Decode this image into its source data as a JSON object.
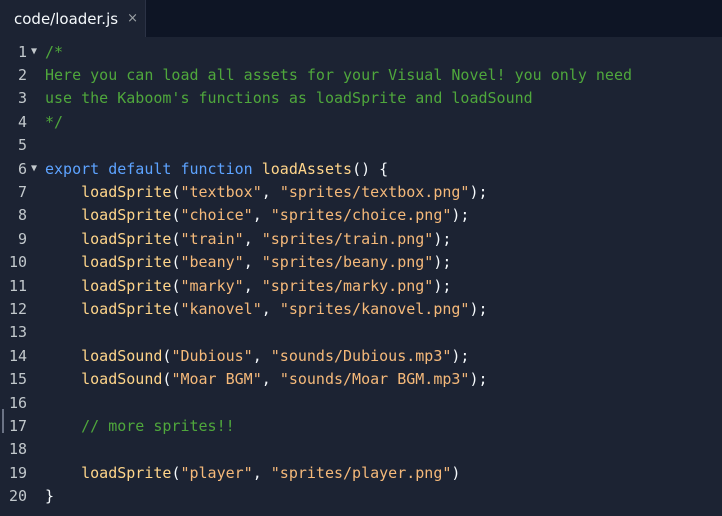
{
  "tab": {
    "title": "code/loader.js",
    "close": "×"
  },
  "fold_marker": "▼",
  "lines": [
    {
      "n": "1",
      "fold": true,
      "tokens": [
        {
          "t": "/*",
          "c": "comment"
        }
      ]
    },
    {
      "n": "2",
      "tokens": [
        {
          "t": "Here you can load all assets for your Visual Novel! you only need",
          "c": "comment"
        }
      ]
    },
    {
      "n": "3",
      "tokens": [
        {
          "t": "use the Kaboom's functions as loadSprite and loadSound",
          "c": "comment"
        }
      ]
    },
    {
      "n": "4",
      "tokens": [
        {
          "t": "*/",
          "c": "comment"
        }
      ]
    },
    {
      "n": "5",
      "tokens": []
    },
    {
      "n": "6",
      "fold": true,
      "tokens": [
        {
          "t": "export",
          "c": "keyword"
        },
        {
          "t": " ",
          "c": "punct"
        },
        {
          "t": "default",
          "c": "keyword"
        },
        {
          "t": " ",
          "c": "punct"
        },
        {
          "t": "function",
          "c": "keyword"
        },
        {
          "t": " ",
          "c": "punct"
        },
        {
          "t": "loadAssets",
          "c": "func"
        },
        {
          "t": "() {",
          "c": "punct"
        }
      ]
    },
    {
      "n": "7",
      "tokens": [
        {
          "t": "    ",
          "c": "punct"
        },
        {
          "t": "loadSprite",
          "c": "func"
        },
        {
          "t": "(",
          "c": "punct"
        },
        {
          "t": "\"textbox\"",
          "c": "string"
        },
        {
          "t": ", ",
          "c": "punct"
        },
        {
          "t": "\"sprites/textbox.png\"",
          "c": "string"
        },
        {
          "t": ");",
          "c": "punct"
        }
      ]
    },
    {
      "n": "8",
      "tokens": [
        {
          "t": "    ",
          "c": "punct"
        },
        {
          "t": "loadSprite",
          "c": "func"
        },
        {
          "t": "(",
          "c": "punct"
        },
        {
          "t": "\"choice\"",
          "c": "string"
        },
        {
          "t": ", ",
          "c": "punct"
        },
        {
          "t": "\"sprites/choice.png\"",
          "c": "string"
        },
        {
          "t": ");",
          "c": "punct"
        }
      ]
    },
    {
      "n": "9",
      "tokens": [
        {
          "t": "    ",
          "c": "punct"
        },
        {
          "t": "loadSprite",
          "c": "func"
        },
        {
          "t": "(",
          "c": "punct"
        },
        {
          "t": "\"train\"",
          "c": "string"
        },
        {
          "t": ", ",
          "c": "punct"
        },
        {
          "t": "\"sprites/train.png\"",
          "c": "string"
        },
        {
          "t": ");",
          "c": "punct"
        }
      ]
    },
    {
      "n": "10",
      "tokens": [
        {
          "t": "    ",
          "c": "punct"
        },
        {
          "t": "loadSprite",
          "c": "func"
        },
        {
          "t": "(",
          "c": "punct"
        },
        {
          "t": "\"beany\"",
          "c": "string"
        },
        {
          "t": ", ",
          "c": "punct"
        },
        {
          "t": "\"sprites/beany.png\"",
          "c": "string"
        },
        {
          "t": ");",
          "c": "punct"
        }
      ]
    },
    {
      "n": "11",
      "tokens": [
        {
          "t": "    ",
          "c": "punct"
        },
        {
          "t": "loadSprite",
          "c": "func"
        },
        {
          "t": "(",
          "c": "punct"
        },
        {
          "t": "\"marky\"",
          "c": "string"
        },
        {
          "t": ", ",
          "c": "punct"
        },
        {
          "t": "\"sprites/marky.png\"",
          "c": "string"
        },
        {
          "t": ");",
          "c": "punct"
        }
      ]
    },
    {
      "n": "12",
      "tokens": [
        {
          "t": "    ",
          "c": "punct"
        },
        {
          "t": "loadSprite",
          "c": "func"
        },
        {
          "t": "(",
          "c": "punct"
        },
        {
          "t": "\"kanovel\"",
          "c": "string"
        },
        {
          "t": ", ",
          "c": "punct"
        },
        {
          "t": "\"sprites/kanovel.png\"",
          "c": "string"
        },
        {
          "t": ");",
          "c": "punct"
        }
      ]
    },
    {
      "n": "13",
      "tokens": []
    },
    {
      "n": "14",
      "tokens": [
        {
          "t": "    ",
          "c": "punct"
        },
        {
          "t": "loadSound",
          "c": "func"
        },
        {
          "t": "(",
          "c": "punct"
        },
        {
          "t": "\"Dubious\"",
          "c": "string"
        },
        {
          "t": ", ",
          "c": "punct"
        },
        {
          "t": "\"sounds/Dubious.mp3\"",
          "c": "string"
        },
        {
          "t": ");",
          "c": "punct"
        }
      ]
    },
    {
      "n": "15",
      "tokens": [
        {
          "t": "    ",
          "c": "punct"
        },
        {
          "t": "loadSound",
          "c": "func"
        },
        {
          "t": "(",
          "c": "punct"
        },
        {
          "t": "\"Moar BGM\"",
          "c": "string"
        },
        {
          "t": ", ",
          "c": "punct"
        },
        {
          "t": "\"sounds/Moar BGM.mp3\"",
          "c": "string"
        },
        {
          "t": ");",
          "c": "punct"
        }
      ]
    },
    {
      "n": "16",
      "tokens": []
    },
    {
      "n": "17",
      "tokens": [
        {
          "t": "    ",
          "c": "punct"
        },
        {
          "t": "// more sprites!!",
          "c": "comment"
        }
      ]
    },
    {
      "n": "18",
      "tokens": []
    },
    {
      "n": "19",
      "tokens": [
        {
          "t": "    ",
          "c": "punct"
        },
        {
          "t": "loadSprite",
          "c": "func"
        },
        {
          "t": "(",
          "c": "punct"
        },
        {
          "t": "\"player\"",
          "c": "string"
        },
        {
          "t": ", ",
          "c": "punct"
        },
        {
          "t": "\"sprites/player.png\"",
          "c": "string"
        },
        {
          "t": ")",
          "c": "punct"
        }
      ]
    },
    {
      "n": "20",
      "tokens": [
        {
          "t": "}",
          "c": "punct"
        }
      ]
    }
  ]
}
